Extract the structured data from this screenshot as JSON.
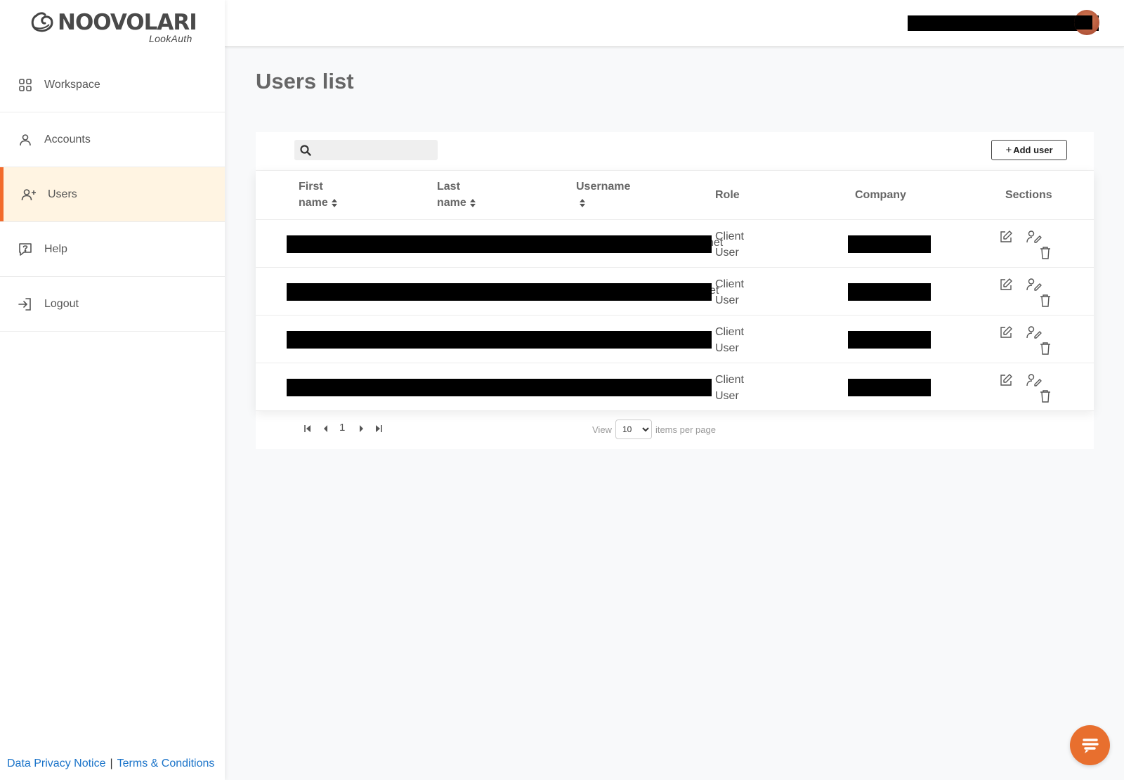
{
  "brand": {
    "name": "NOOVOLARI",
    "sub": "LookAuth"
  },
  "sidebar": {
    "items": [
      {
        "label": "Workspace",
        "icon": "grid-icon",
        "active": false
      },
      {
        "label": "Accounts",
        "icon": "user-icon",
        "active": false
      },
      {
        "label": "Users",
        "icon": "user-plus-icon",
        "active": true
      },
      {
        "label": "Help",
        "icon": "help-bubble-icon",
        "active": false
      },
      {
        "label": "Logout",
        "icon": "logout-icon",
        "active": false
      }
    ]
  },
  "footer": {
    "privacy": "Data Privacy Notice",
    "separator": "|",
    "terms": "Terms & Conditions"
  },
  "page": {
    "title": "Users list"
  },
  "toolbar": {
    "search_placeholder": "",
    "add_label": "Add user",
    "add_plus": "+"
  },
  "table": {
    "columns": {
      "first_name_1": "First",
      "first_name_2": "name",
      "last_name_1": "Last",
      "last_name_2": "name",
      "username": "Username",
      "role": "Role",
      "company": "Company",
      "sections": "Sections"
    },
    "rows": [
      {
        "role_1": "Client",
        "role_2": "User",
        "peek": "net"
      },
      {
        "role_1": "Client",
        "role_2": "User",
        "peek": "et"
      },
      {
        "role_1": "Client",
        "role_2": "User",
        "peek": ""
      },
      {
        "role_1": "Client",
        "role_2": "User",
        "peek": ""
      }
    ]
  },
  "pagination": {
    "page": "1",
    "view_label": "View",
    "per_page": "10",
    "per_page_options": [
      "10"
    ],
    "items_label": "items per page"
  },
  "colors": {
    "accent": "#f26b2c",
    "active_bg": "#fff4e2",
    "link": "#1a73c9",
    "chat": "#e86f2e"
  }
}
